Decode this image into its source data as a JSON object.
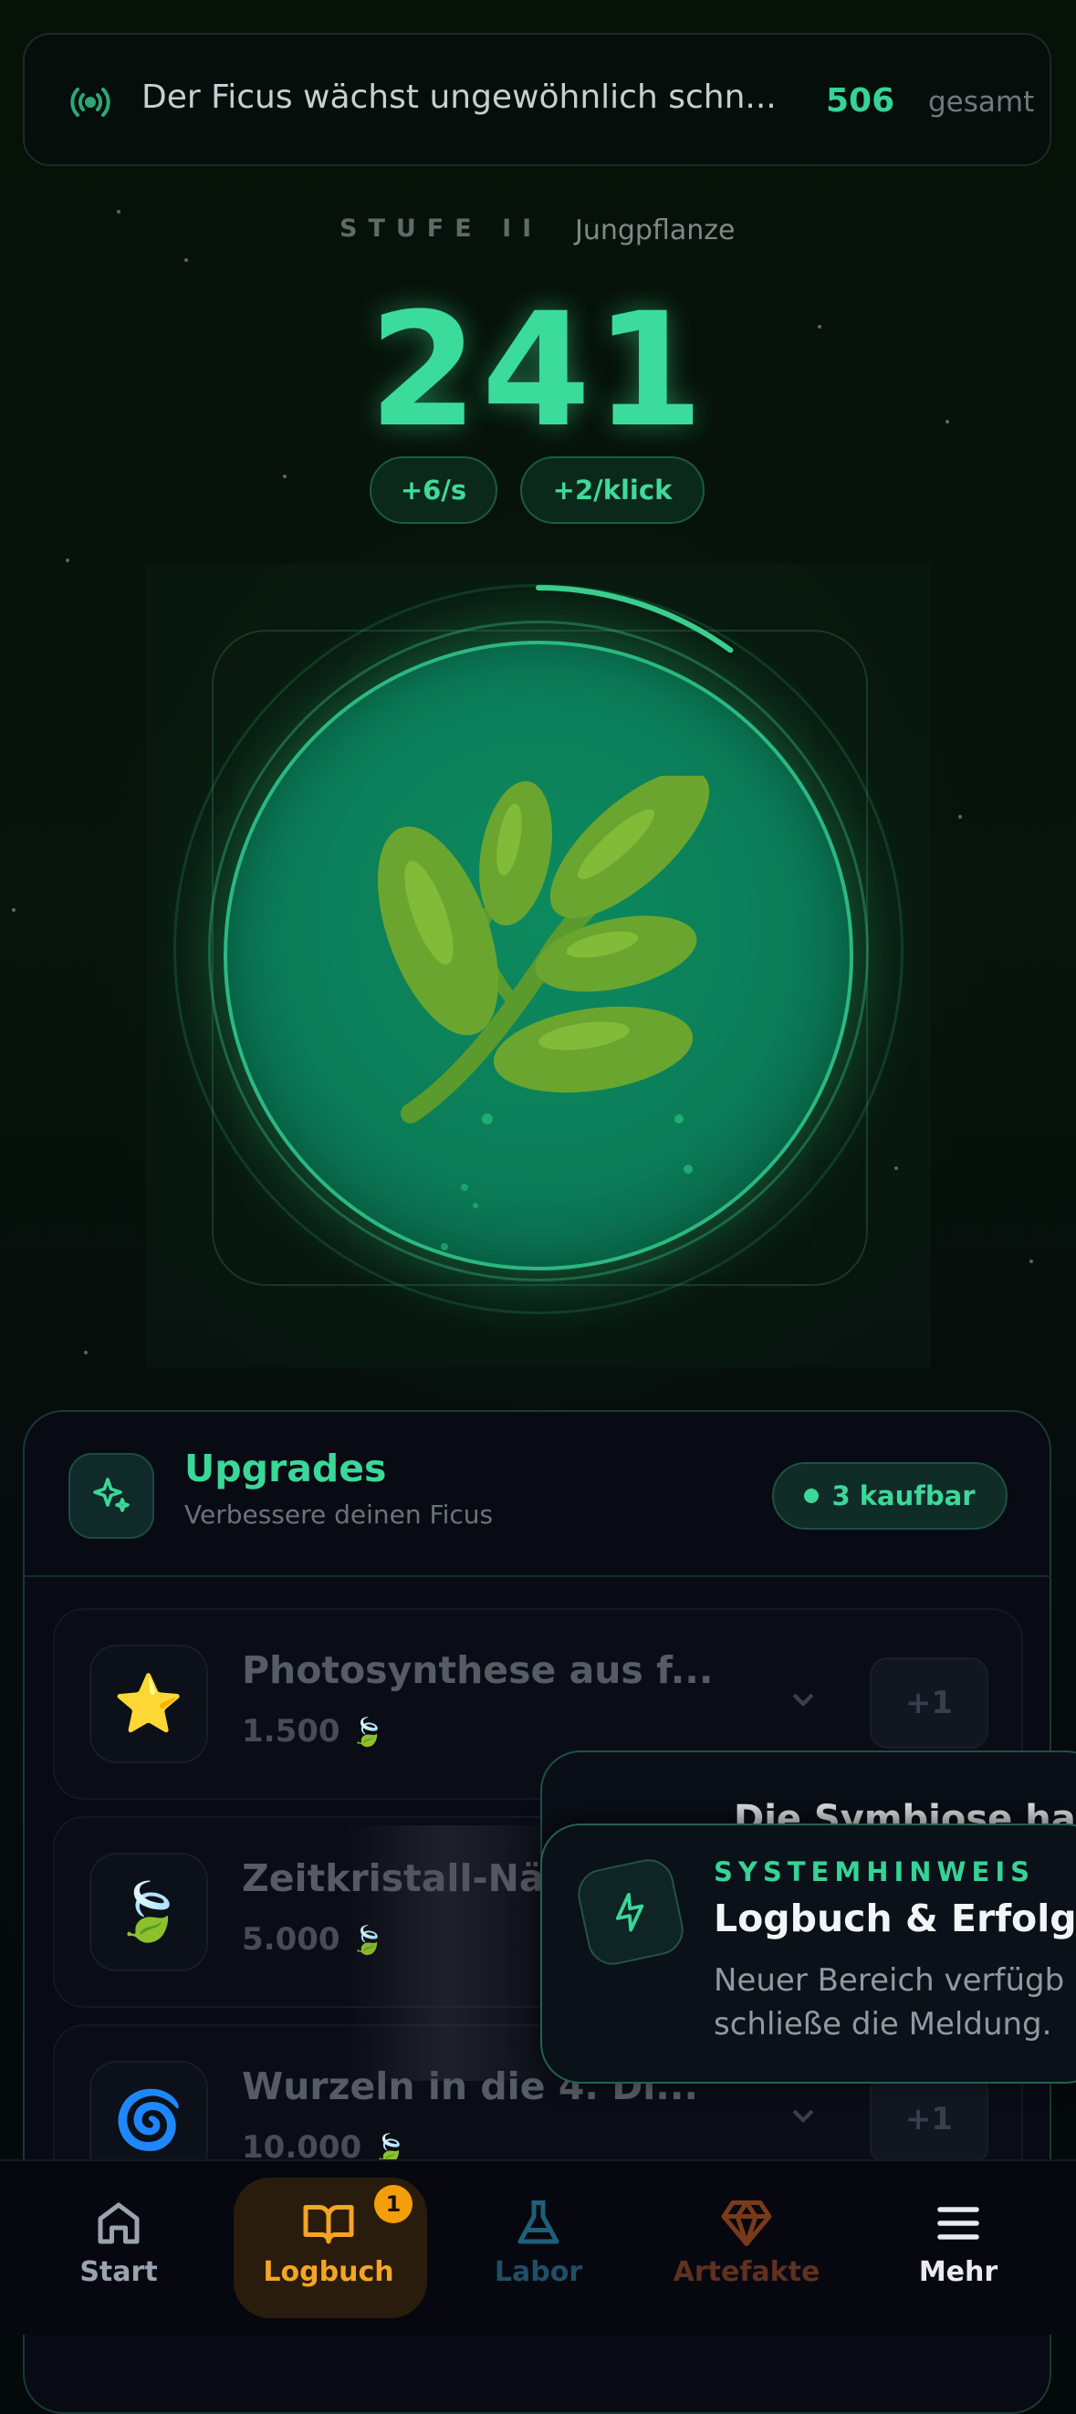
{
  "ticker": {
    "message": "Der Ficus wächst ungewöhnlich schn...",
    "total_value": "506",
    "total_label": "gesamt",
    "icon": "broadcast-icon"
  },
  "stage": {
    "label": "STUFE II",
    "name": "Jungpflanze"
  },
  "counter": {
    "value": "241",
    "per_second": "+6/s",
    "per_click": "+2/klick"
  },
  "plant": {
    "icon": "plant-sprout-icon",
    "growth_progress": 0.1
  },
  "upgrades": {
    "title": "Upgrades",
    "subtitle": "Verbessere deinen Ficus",
    "buyable": "3 kaufbar",
    "items": [
      {
        "name": "Photosynthese aus f...",
        "price": "1.500",
        "icon": "star-icon",
        "emoji": "⭐",
        "action": "+1"
      },
      {
        "name": "Zeitkristall-Nä",
        "price": "5.000",
        "icon": "leaf-icon",
        "emoji": "🍃",
        "action": "+1"
      },
      {
        "name": "Wurzeln in die 4. Di...",
        "price": "10.000",
        "icon": "spiral-icon",
        "emoji": "🌀",
        "action": "+1"
      }
    ]
  },
  "toast_back": {
    "title": "Die Symbiose ha"
  },
  "toast": {
    "label": "SYSTEMHINWEIS",
    "title": "Logbuch & Erfolg",
    "line1": "Neuer Bereich verfügb",
    "line2": "schließe die Meldung."
  },
  "nav": {
    "items": [
      {
        "label": "Start",
        "icon": "home-icon"
      },
      {
        "label": "Logbuch",
        "icon": "book-icon",
        "badge": "1",
        "active": true
      },
      {
        "label": "Labor",
        "icon": "flask-icon"
      },
      {
        "label": "Artefakte",
        "icon": "gem-icon"
      },
      {
        "label": "Mehr",
        "icon": "menu-icon"
      }
    ]
  },
  "colors": {
    "accent": "#3bdc9b",
    "active_nav": "#f5a524",
    "background": "#04090a"
  }
}
